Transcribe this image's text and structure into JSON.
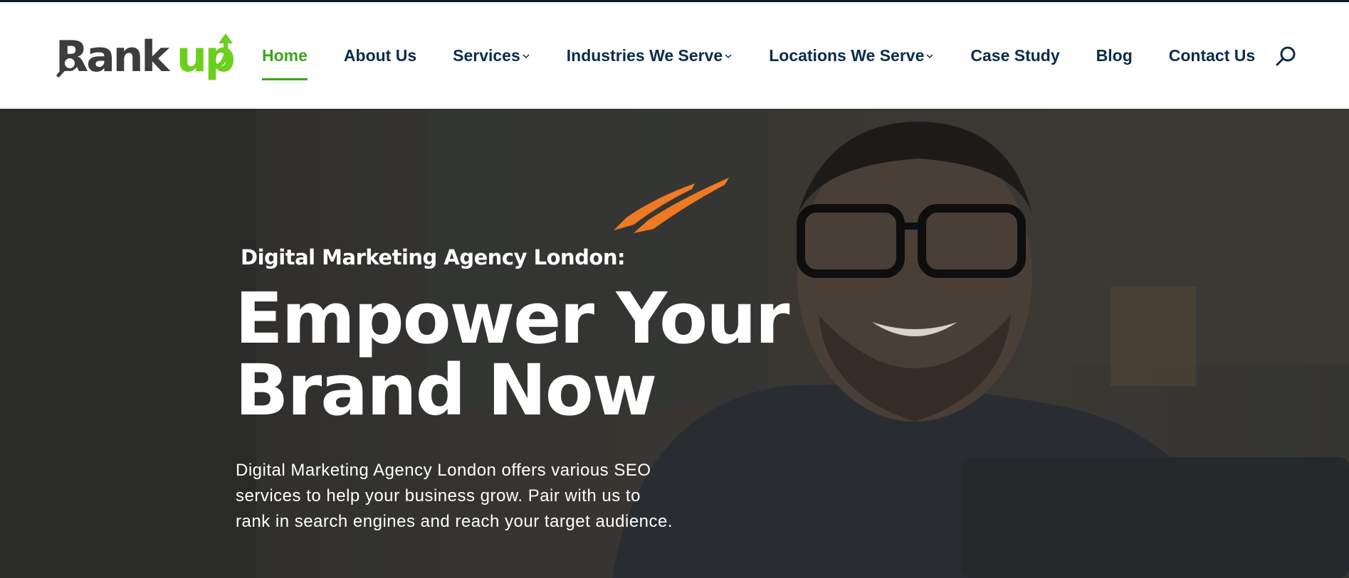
{
  "brand": {
    "name_part1": "Rank",
    "name_part2": "up",
    "colors": {
      "dark": "#3d3d3d",
      "green": "#6bd01c",
      "accent": "#3fa31a",
      "nav_text": "#0c2c4b",
      "brush": "#f07a24"
    }
  },
  "nav": {
    "items": [
      {
        "label": "Home",
        "active": true,
        "dropdown": false
      },
      {
        "label": "About Us",
        "active": false,
        "dropdown": false
      },
      {
        "label": "Services",
        "active": false,
        "dropdown": true
      },
      {
        "label": "Industries We Serve",
        "active": false,
        "dropdown": true
      },
      {
        "label": "Locations We Serve",
        "active": false,
        "dropdown": true
      },
      {
        "label": "Case Study",
        "active": false,
        "dropdown": false
      },
      {
        "label": "Blog",
        "active": false,
        "dropdown": false
      },
      {
        "label": "Contact Us",
        "active": false,
        "dropdown": false
      }
    ],
    "search_icon": "search-icon"
  },
  "hero": {
    "eyebrow": "Digital Marketing Agency London:",
    "headline_line1": "Empower Your",
    "headline_line2": "Brand Now",
    "description_line1": "Digital Marketing Agency London offers various SEO",
    "description_line2": "services to help your business grow. Pair with us to",
    "description_line3": "rank in search engines and reach your target audience."
  }
}
